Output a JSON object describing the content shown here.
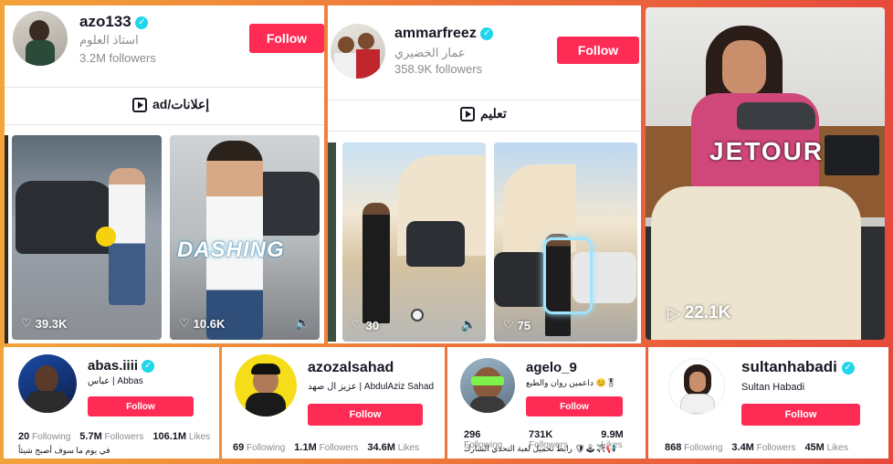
{
  "profiles_top": [
    {
      "username": "azo133",
      "display_name": "استاذ العلوم",
      "followers": "3.2M followers",
      "follow_label": "Follow",
      "tab_label": "ad/إعلانات",
      "videos": [
        {
          "likes": "39.3K"
        },
        {
          "likes": "10.6K",
          "overlay": "DASHING"
        }
      ]
    },
    {
      "username": "ammarfreez",
      "display_name": "عمار الخضيري",
      "followers": "358.9K followers",
      "follow_label": "Follow",
      "tab_label": "تعليم",
      "videos": [
        {
          "likes": "30"
        },
        {
          "likes": "75"
        }
      ]
    },
    {
      "overlay": "JETOUR",
      "views": "22.1K"
    }
  ],
  "profiles_bottom": [
    {
      "username": "abas.iiii",
      "display_name": "عباس | Abbas",
      "follow_label": "Follow",
      "following": "20",
      "followers": "5.7M",
      "likes": "106.1M",
      "label_following": "Following",
      "label_followers": "Followers",
      "label_likes": "Likes",
      "bio": "في يوم ما سوف أصبح شيئاً"
    },
    {
      "username": "azozalsahad",
      "display_name": "عزيز ال صهد | AbdulAziz Sahad",
      "follow_label": "Follow",
      "following": "69",
      "followers": "1.1M",
      "likes": "34.6M",
      "label_following": "Following",
      "label_followers": "Followers",
      "label_likes": "Likes"
    },
    {
      "username": "agelo_9",
      "display_name": "داعمين روان والطبع 😊🎖",
      "follow_label": "Follow",
      "following": "296",
      "followers": "731K",
      "likes": "9.9M",
      "label_following": "Following",
      "label_followers": "Followers",
      "label_likes": "Likes",
      "bio": "رابط تحميل لعبة التحدي الشارك 🛡🕹✈📢"
    },
    {
      "username": "sultanhabadi",
      "display_name": "Sultan Habadi",
      "follow_label": "Follow",
      "following": "868",
      "followers": "3.4M",
      "likes": "45M",
      "label_following": "Following",
      "label_followers": "Followers",
      "label_likes": "Likes"
    }
  ],
  "colors": {
    "follow": "#fe2c55",
    "verified": "#20d5ec"
  }
}
